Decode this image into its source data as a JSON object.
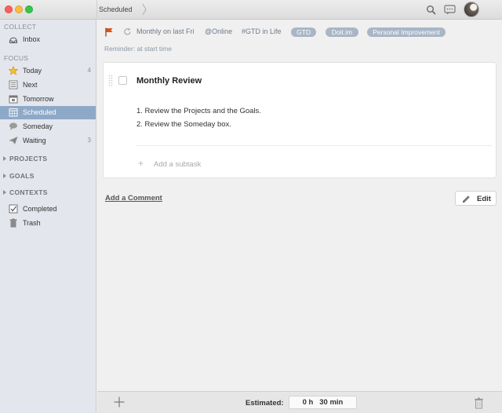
{
  "window": {
    "title": "Scheduled"
  },
  "sidebar": {
    "sections": {
      "collect": "COLLECT",
      "focus": "FOCUS"
    },
    "collect_items": [
      {
        "label": "Inbox",
        "icon": "inbox-icon",
        "count": ""
      }
    ],
    "focus_items": [
      {
        "label": "Today",
        "icon": "star-icon",
        "count": "4"
      },
      {
        "label": "Next",
        "icon": "list-icon",
        "count": ""
      },
      {
        "label": "Tomorrow",
        "icon": "calendar-icon",
        "count": ""
      },
      {
        "label": "Scheduled",
        "icon": "calendar-grid-icon",
        "count": "",
        "active": true
      },
      {
        "label": "Someday",
        "icon": "speech-bubble-icon",
        "count": ""
      },
      {
        "label": "Waiting",
        "icon": "paper-plane-icon",
        "count": "3"
      }
    ],
    "groups": [
      "PROJECTS",
      "GOALS",
      "CONTEXTS"
    ],
    "bottom_items": [
      {
        "label": "Completed",
        "icon": "checkbox-icon"
      },
      {
        "label": "Trash",
        "icon": "trash-icon"
      }
    ]
  },
  "task": {
    "repeat": "Monthly on last Fri",
    "context": "@Online",
    "project": "#GTD in Life",
    "tags": [
      "GTD",
      "Doit.im",
      "Personal Improvement"
    ],
    "reminder": "Reminder: at start time",
    "title": "Monthly Review",
    "notes": [
      "1. Review the Projects and the Goals.",
      "2. Review the Someday box."
    ],
    "add_subtask": "Add a subtask",
    "flag_color": "#d9541e",
    "tag_color": "#a8b6c6"
  },
  "actions": {
    "add_comment": "Add a Comment",
    "edit": "Edit"
  },
  "footer": {
    "estimated_label": "Estimated:",
    "estimated_value": "0 h   30 min"
  },
  "colors": {
    "sidebar_active": "#8ea9c8",
    "sidebar_bg": "#e3e6ec"
  }
}
